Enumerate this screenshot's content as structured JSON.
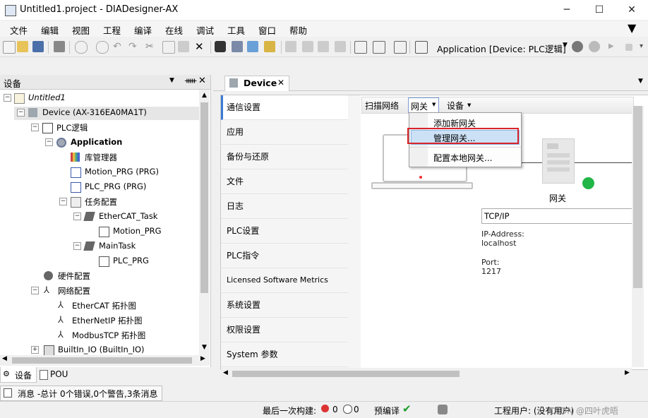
{
  "window": {
    "title": "Untitled1.project - DIADesigner-AX",
    "minimize": "─",
    "maximize": "☐",
    "close": "✕"
  },
  "menu": [
    "文件",
    "编辑",
    "视图",
    "工程",
    "编译",
    "在线",
    "调试",
    "工具",
    "窗口",
    "帮助"
  ],
  "toolbar": {
    "application_selector": "Application [Device: PLC逻辑]"
  },
  "left_panel": {
    "title": "设备",
    "tree": [
      {
        "label": "Untitled1",
        "italic": true
      },
      {
        "label": "Device (AX-316EA0MA1T)"
      },
      {
        "label": "PLC逻辑"
      },
      {
        "label": "Application",
        "bold": true
      },
      {
        "label": "库管理器"
      },
      {
        "label": "Motion_PRG (PRG)"
      },
      {
        "label": "PLC_PRG (PRG)"
      },
      {
        "label": "任务配置"
      },
      {
        "label": "EtherCAT_Task"
      },
      {
        "label": "Motion_PRG"
      },
      {
        "label": "MainTask"
      },
      {
        "label": "PLC_PRG"
      },
      {
        "label": "硬件配置"
      },
      {
        "label": "网络配置"
      },
      {
        "label": "EtherCAT 拓扑图"
      },
      {
        "label": "EtherNetIP 拓扑图"
      },
      {
        "label": "ModbusTCP 拓扑图"
      },
      {
        "label": "BuiltIn_IO (BuiltIn_IO)"
      }
    ],
    "bottom_tabs": [
      "设备",
      "POU"
    ]
  },
  "editor": {
    "tab": "Device",
    "nav": [
      "通信设置",
      "应用",
      "备份与还原",
      "文件",
      "日志",
      "PLC设置",
      "PLC指令",
      "Licensed Software Metrics",
      "系统设置",
      "权限设置",
      "System 参数"
    ],
    "subbar": {
      "scan": "扫描网络",
      "gateway": "网关",
      "device": "设备"
    },
    "dropdown": [
      "添加新网关",
      "管理网关...",
      "配置本地网关..."
    ],
    "gateway_label": "网关",
    "protocol": "TCP/IP",
    "ip_label": "IP-Address:",
    "ip_value": "localhost",
    "port_label": "Port:",
    "port_value": "1217"
  },
  "messages": "消息 -总计 0个错误,0个警告,3条消息",
  "status": {
    "last_build": "最后一次构建:",
    "errors": "0",
    "warnings": "0",
    "precompile": "预编译",
    "user": "工程用户: (没有用户)",
    "watermark": "CSDN @四叶虎晤"
  },
  "colors": {
    "accent": "#3a7bd5",
    "highlight": "#d9242a",
    "online_dot": "#22b548"
  }
}
